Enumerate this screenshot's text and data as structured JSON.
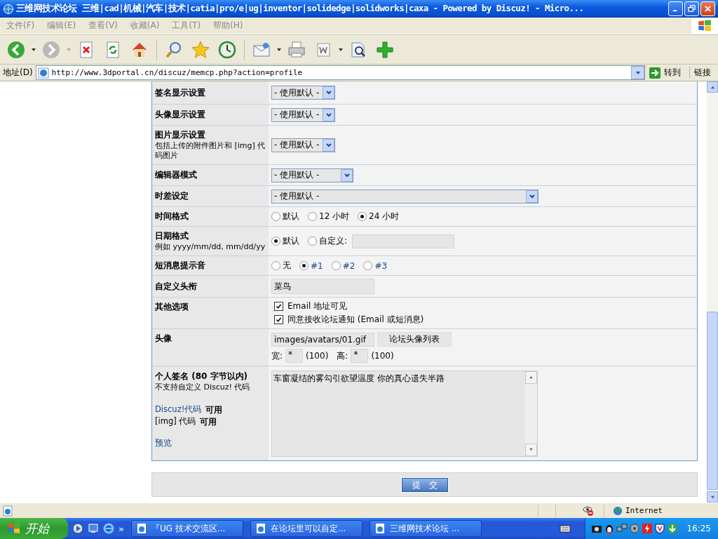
{
  "window": {
    "title": "三维网技术论坛 三维|cad|机械|汽车|技术|catia|pro/e|ug|inventor|solidedge|solidworks|caxa - Powered by Discuz! - Micro..."
  },
  "menu": [
    "文件(F)",
    "编辑(E)",
    "查看(V)",
    "收藏(A)",
    "工具(T)",
    "帮助(H)"
  ],
  "address": {
    "label": "地址(D)",
    "url": "http://www.3dportal.cn/discuz/memcp.php?action=profile",
    "go": "转到",
    "links": "链接"
  },
  "form": {
    "rows": [
      {
        "kind": "select",
        "label": "签名显示设置",
        "value": "- 使用默认 -"
      },
      {
        "kind": "select",
        "label": "头像显示设置",
        "value": "- 使用默认 -"
      },
      {
        "kind": "select",
        "label": "图片显示设置",
        "note": "包括上传的附件图片和 [img] 代码图片",
        "value": "- 使用默认 -"
      },
      {
        "kind": "wideselect",
        "label": "编辑器模式",
        "value": "- 使用默认 -"
      },
      {
        "kind": "fullselect",
        "label": "时差设定",
        "value": "- 使用默认 -"
      },
      {
        "kind": "radio",
        "label": "时间格式",
        "options": [
          {
            "label": "默认",
            "selected": false,
            "linked": false
          },
          {
            "label": "12 小时",
            "selected": false,
            "linked": false
          },
          {
            "label": "24 小时",
            "selected": true,
            "linked": false
          }
        ]
      },
      {
        "kind": "radio",
        "label": "日期格式",
        "note": "例如  yyyy/mm/dd, mm/dd/yy",
        "options": [
          {
            "label": "默认",
            "selected": true,
            "linked": false
          },
          {
            "label": "自定义:",
            "selected": false,
            "linked": false,
            "field": true
          }
        ]
      },
      {
        "kind": "radio",
        "label": "短消息提示音",
        "options": [
          {
            "label": "无",
            "selected": false,
            "linked": false
          },
          {
            "label": "#1",
            "selected": true,
            "linked": true
          },
          {
            "label": "#2",
            "selected": false,
            "linked": true
          },
          {
            "label": "#3",
            "selected": false,
            "linked": true
          }
        ]
      },
      {
        "kind": "text",
        "label": "自定义头衔",
        "value": "菜鸟"
      },
      {
        "kind": "checkbox",
        "label": "其他选项",
        "options": [
          {
            "label": "Email 地址可见",
            "checked": true
          },
          {
            "label": "同意接收论坛通知 (Email 或短消息)",
            "checked": true
          }
        ]
      },
      {
        "kind": "avatar",
        "label": "头像",
        "value": "images/avatars/01.gif",
        "button": "论坛头像列表",
        "width_label": "宽:",
        "width_value": "*",
        "width_max": "(100)",
        "height_label": "高:",
        "height_value": "*",
        "height_max": "(100)"
      },
      {
        "kind": "signature",
        "label": "个人签名 (80 字节以内)",
        "note": "不支持自定义  Discuz! 代码",
        "codes": [
          {
            "name": "Discuz!代码",
            "linked": true,
            "status": "可用"
          },
          {
            "name": "[img] 代码",
            "linked": false,
            "status": "可用"
          }
        ],
        "preview": "预览",
        "value": "车窗凝结的雾勾引欲望温度 你的真心遗失半路"
      }
    ],
    "submit": "提　交"
  },
  "status_bar": {
    "zone": "Internet"
  },
  "taskbar": {
    "start": "开始",
    "more": "»",
    "tasks": [
      "『UG 技术交流区...",
      "在论坛里可以自定...",
      "三维网技术论坛 ..."
    ],
    "clock": "16:25"
  }
}
